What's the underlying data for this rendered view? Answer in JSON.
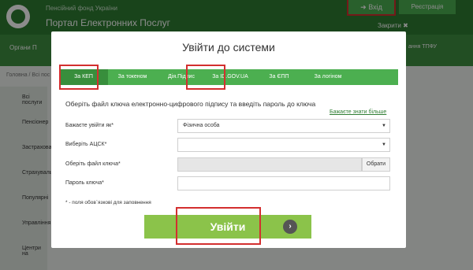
{
  "header": {
    "subtitle": "Пенсійний фонд України",
    "title": "Портал Електронних Послуг",
    "login_label": "Вхід",
    "register_label": "Реєстрація",
    "close_label": "Закрити"
  },
  "nav": {
    "left": "Органи П",
    "right": "ання ТПФУ"
  },
  "breadcrumb": "Головна / Всі пос",
  "sidebar": {
    "items": [
      "Всі послуги",
      "Пенсіонер",
      "Застрахова",
      "Страхуваль",
      "Популярні",
      "Управління",
      "Центри на"
    ]
  },
  "modal": {
    "title": "Увійти до системи",
    "tabs": [
      "За КЕП",
      "За токеном",
      "Дія.Підпис",
      "За ID.GOV.UA",
      "За ЄПП",
      "За логіном"
    ],
    "prompt": "Оберіть файл ключа електронно-цифрового підпису та введіть пароль до ключа",
    "link": "Бажаєте знати більше",
    "labels": {
      "login_as": "Бажаєте увійти як*",
      "acsk": "Виберіть АЦСК*",
      "key_file": "Оберіть файл ключа*",
      "password": "Пароль ключа*"
    },
    "values": {
      "login_as": "Фізична особа",
      "acsk": "",
      "key_file": "",
      "password": ""
    },
    "file_button": "Обрати",
    "required_note": "* - поля обов`язкові для заповнення",
    "submit": "Увійти"
  }
}
